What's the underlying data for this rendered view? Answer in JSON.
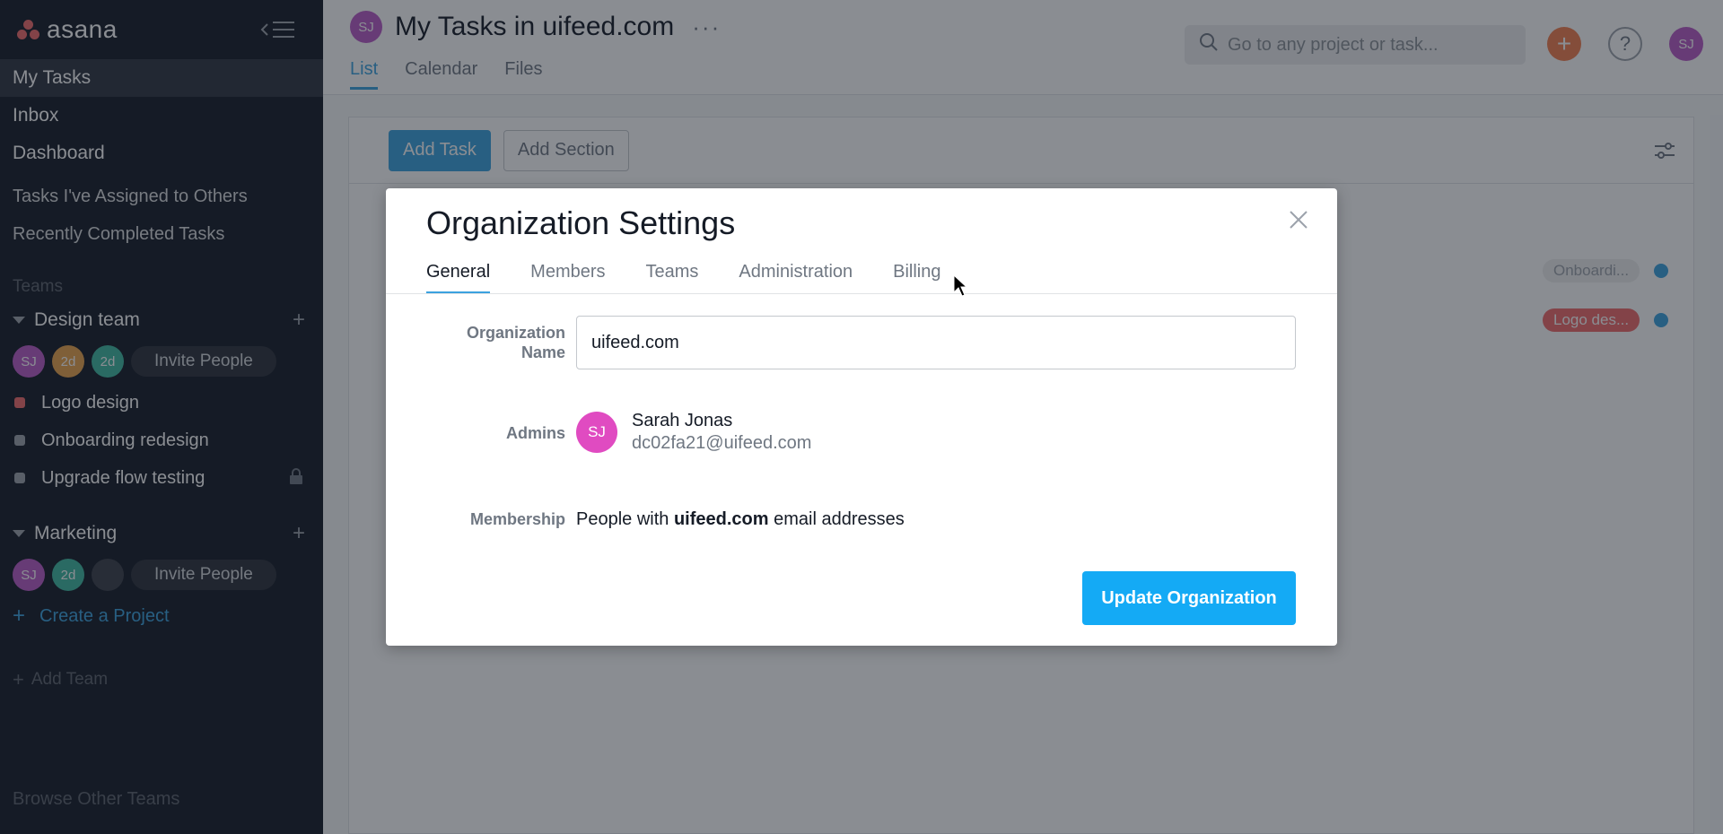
{
  "sidebar": {
    "logo_text": "asana",
    "nav": [
      "My Tasks",
      "Inbox",
      "Dashboard"
    ],
    "nav_small": [
      "Tasks I've Assigned to Others",
      "Recently Completed Tasks"
    ],
    "teams_label": "Teams",
    "teams": [
      {
        "name": "Design team",
        "members": [
          {
            "initials": "SJ",
            "color": "#b95ac7"
          },
          {
            "initials": "2d",
            "color": "#e8a24b"
          },
          {
            "initials": "2d",
            "color": "#3fb8a0"
          }
        ],
        "invite_label": "Invite People",
        "projects": [
          {
            "name": "Logo design",
            "color": "#f06a6a",
            "locked": false
          },
          {
            "name": "Onboarding redesign",
            "color": "#9ca2ab",
            "locked": false
          },
          {
            "name": "Upgrade flow testing",
            "color": "#9ca2ab",
            "locked": true
          }
        ]
      },
      {
        "name": "Marketing",
        "members": [
          {
            "initials": "SJ",
            "color": "#b95ac7"
          },
          {
            "initials": "2d",
            "color": "#3fb8a0"
          },
          {
            "initials": "",
            "color": "#3a3f49"
          }
        ],
        "invite_label": "Invite People",
        "projects": []
      }
    ],
    "create_project": "Create a Project",
    "add_team": "Add Team",
    "browse_teams": "Browse Other Teams"
  },
  "header": {
    "avatar_initials": "SJ",
    "title": "My Tasks in uifeed.com",
    "more": "···",
    "tabs": [
      "List",
      "Calendar",
      "Files"
    ],
    "active_tab": "List",
    "search_placeholder": "Go to any project or task...",
    "user_initials": "SJ"
  },
  "toolbar": {
    "add_task": "Add Task",
    "add_section": "Add Section"
  },
  "task_tags": [
    {
      "label": "Onboardi...",
      "bg": "#eeeeee",
      "fg": "#9ca2ab"
    },
    {
      "label": "Logo des...",
      "bg": "#f06a6a",
      "fg": "#ffffff"
    }
  ],
  "modal": {
    "title": "Organization Settings",
    "tabs": [
      "General",
      "Members",
      "Teams",
      "Administration",
      "Billing"
    ],
    "active_tab": "General",
    "org_name_label_line1": "Organization",
    "org_name_label_line2": "Name",
    "org_name_value": "uifeed.com",
    "admins_label": "Admins",
    "admin": {
      "initials": "SJ",
      "name": "Sarah Jonas",
      "email": "dc02fa21@uifeed.com"
    },
    "membership_label": "Membership",
    "membership_prefix": "People with ",
    "membership_domain": "uifeed.com",
    "membership_suffix": " email addresses",
    "update_button": "Update Organization"
  }
}
